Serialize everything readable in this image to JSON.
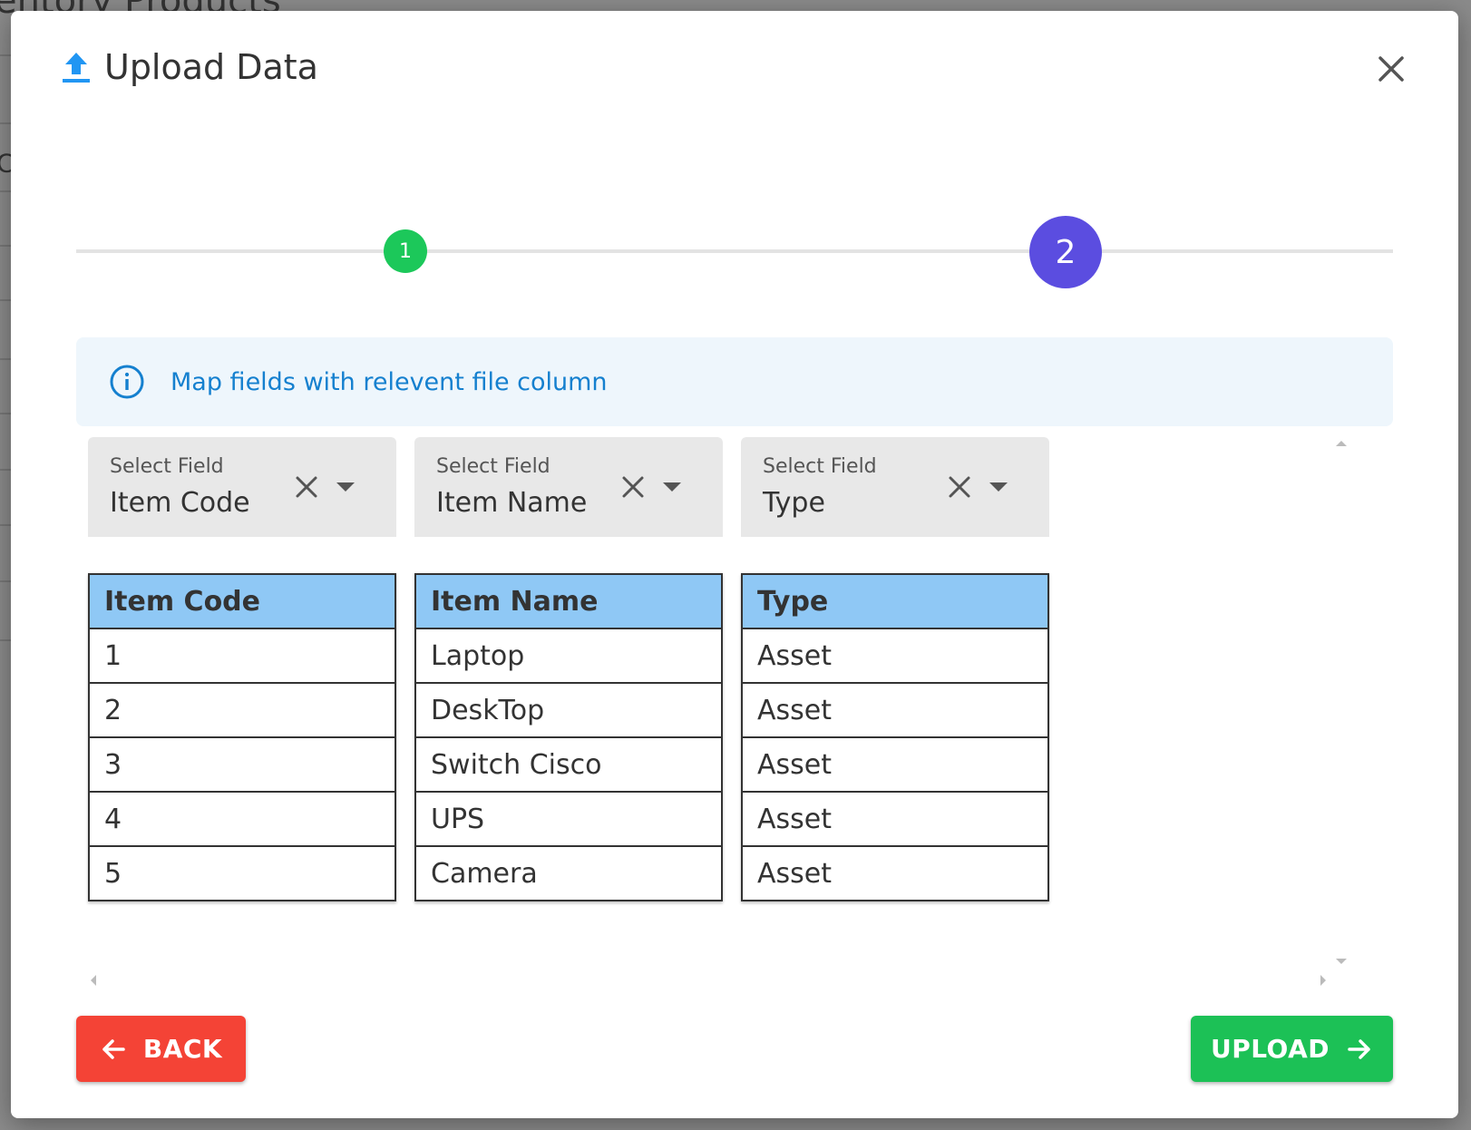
{
  "background": {
    "title": "entory Products",
    "fragment": "C"
  },
  "dialog": {
    "title": "Upload Data",
    "icons": {
      "title": "upload-icon",
      "close": "close-icon"
    }
  },
  "stepper": {
    "steps": [
      {
        "label": "1",
        "state": "completed",
        "color": "#1cc85a"
      },
      {
        "label": "2",
        "state": "active",
        "color": "#5b4de0"
      }
    ]
  },
  "info": {
    "text": "Map fields with relevent file column",
    "icon": "info-icon",
    "color": "#1580cf"
  },
  "columns": [
    {
      "select_label": "Select Field",
      "select_value": "Item Code",
      "header": "Item Code",
      "rows": [
        "1",
        "2",
        "3",
        "4",
        "5"
      ]
    },
    {
      "select_label": "Select Field",
      "select_value": "Item Name",
      "header": "Item Name",
      "rows": [
        "Laptop",
        "DeskTop",
        "Switch Cisco",
        "UPS",
        "Camera"
      ]
    },
    {
      "select_label": "Select Field",
      "select_value": "Type",
      "header": "Type",
      "rows": [
        "Asset",
        "Asset",
        "Asset",
        "Asset",
        "Asset"
      ]
    }
  ],
  "footer": {
    "back_label": "BACK",
    "upload_label": "UPLOAD",
    "back_color": "#f44336",
    "upload_color": "#1cc156"
  }
}
